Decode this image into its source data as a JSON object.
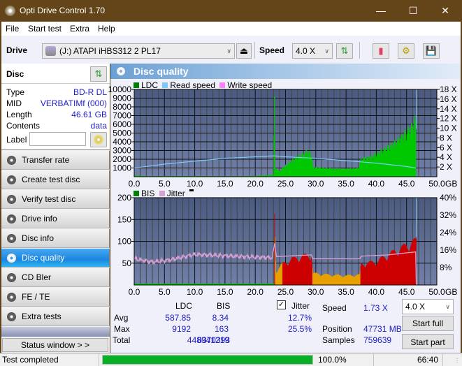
{
  "window": {
    "title": "Opti Drive Control 1.70",
    "minimize": "—",
    "maximize": "☐",
    "close": "✕"
  },
  "menu": [
    "File",
    "Start test",
    "Extra",
    "Help"
  ],
  "toolbar": {
    "drive_label": "Drive",
    "drive_value": "(J:)   ATAPI iHBS312   2 PL17",
    "speed_label": "Speed",
    "speed_value": "4.0 X"
  },
  "disc": {
    "heading": "Disc",
    "type_label": "Type",
    "type_value": "BD-R DL",
    "mid_label": "MID",
    "mid_value": "VERBATIMf (000)",
    "length_label": "Length",
    "length_value": "46.61 GB",
    "contents_label": "Contents",
    "contents_value": "data",
    "label_label": "Label",
    "label_value": ""
  },
  "nav": [
    {
      "label": "Transfer rate",
      "active": false
    },
    {
      "label": "Create test disc",
      "active": false
    },
    {
      "label": "Verify test disc",
      "active": false
    },
    {
      "label": "Drive info",
      "active": false
    },
    {
      "label": "Disc info",
      "active": false
    },
    {
      "label": "Disc quality",
      "active": true
    },
    {
      "label": "CD Bler",
      "active": false
    },
    {
      "label": "FE / TE",
      "active": false
    },
    {
      "label": "Extra tests",
      "active": false
    }
  ],
  "status_window_label": "Status window > >",
  "panel_title": "Disc quality",
  "colors": {
    "ldc": "#00c800",
    "read_speed": "#7fc8f8",
    "write_speed": "#ff80ff",
    "bis_legend": "#008000",
    "jitter": "#d8a0d0",
    "bis_high": "#cc0000",
    "bis_mid": "#e8a000",
    "plot_top": "#4a5a80",
    "plot_bottom": "#7080a8",
    "progress": "#06b025"
  },
  "chart_data": [
    {
      "type": "bar",
      "title": "LDC / Read speed",
      "legend": [
        "LDC",
        "Read speed",
        "Write speed"
      ],
      "x_ticks": [
        "0.0",
        "5.0",
        "10.0",
        "15.0",
        "20.0",
        "25.0",
        "30.0",
        "35.0",
        "40.0",
        "45.0",
        "50.0"
      ],
      "x_unit": "GB",
      "xlim": [
        0,
        50
      ],
      "ylim_left": [
        0,
        10000
      ],
      "y_ticks_left": [
        "1000",
        "2000",
        "3000",
        "4000",
        "5000",
        "6000",
        "7000",
        "8000",
        "9000",
        "10000"
      ],
      "ylim_right": [
        0,
        18
      ],
      "y_ticks_right": [
        "2 X",
        "4 X",
        "6 X",
        "8 X",
        "10 X",
        "12 X",
        "14 X",
        "16 X",
        "18 X"
      ],
      "ldc_series": [
        [
          0,
          150
        ],
        [
          2,
          60
        ],
        [
          5,
          80
        ],
        [
          10,
          80
        ],
        [
          15,
          60
        ],
        [
          20,
          90
        ],
        [
          23,
          200
        ],
        [
          23.2,
          9192
        ],
        [
          23.3,
          1000
        ],
        [
          24,
          600
        ],
        [
          25,
          1200
        ],
        [
          26,
          1700
        ],
        [
          27,
          2200
        ],
        [
          28,
          2400
        ],
        [
          28.5,
          2700
        ],
        [
          29.3,
          2500
        ],
        [
          29.5,
          1100
        ],
        [
          30,
          1000
        ],
        [
          32,
          900
        ],
        [
          34,
          850
        ],
        [
          37,
          900
        ],
        [
          37.5,
          1900
        ],
        [
          39,
          2100
        ],
        [
          41,
          2800
        ],
        [
          43,
          3600
        ],
        [
          45,
          4800
        ],
        [
          46.2,
          5600
        ],
        [
          46.6,
          6700
        ]
      ],
      "read_speed_series": [
        [
          0,
          1.8
        ],
        [
          5,
          2.6
        ],
        [
          10,
          3.2
        ],
        [
          15,
          3.8
        ],
        [
          20,
          4.1
        ],
        [
          23.2,
          4.3
        ],
        [
          25,
          4.1
        ],
        [
          30,
          3.8
        ],
        [
          35,
          3.3
        ],
        [
          40,
          2.8
        ],
        [
          45,
          2.1
        ],
        [
          46.6,
          1.8
        ]
      ],
      "end_marker_gb": 46.61
    },
    {
      "type": "bar",
      "title": "BIS / Jitter",
      "legend": [
        "BIS",
        "Jitter"
      ],
      "x_ticks": [
        "0.0",
        "5.0",
        "10.0",
        "15.0",
        "20.0",
        "25.0",
        "30.0",
        "35.0",
        "40.0",
        "45.0",
        "50.0"
      ],
      "x_unit": "GB",
      "xlim": [
        0,
        50
      ],
      "ylim_left": [
        0,
        200
      ],
      "y_ticks_left": [
        "50",
        "100",
        "150",
        "200"
      ],
      "ylim_right": [
        0,
        40
      ],
      "y_ticks_right": [
        "8%",
        "16%",
        "24%",
        "32%",
        "40%"
      ],
      "bis_series": [
        [
          0,
          2
        ],
        [
          10,
          2
        ],
        [
          20,
          2
        ],
        [
          23,
          3
        ],
        [
          23.2,
          163
        ],
        [
          23.4,
          30
        ],
        [
          24.5,
          45
        ],
        [
          26,
          55
        ],
        [
          28,
          62
        ],
        [
          29.3,
          65
        ],
        [
          29.5,
          25
        ],
        [
          32,
          22
        ],
        [
          35,
          20
        ],
        [
          37.3,
          22
        ],
        [
          37.5,
          45
        ],
        [
          40,
          50
        ],
        [
          42,
          65
        ],
        [
          44,
          78
        ],
        [
          45.5,
          88
        ],
        [
          46.6,
          95
        ]
      ],
      "jitter_series": [
        [
          0,
          12
        ],
        [
          3,
          10.5
        ],
        [
          6,
          11.5
        ],
        [
          10,
          14
        ],
        [
          14,
          13.5
        ],
        [
          18,
          13
        ],
        [
          22.8,
          12.5
        ],
        [
          23.2,
          19
        ],
        [
          23.5,
          13
        ],
        [
          25,
          13.2
        ],
        [
          29.3,
          13.8
        ],
        [
          29.5,
          12
        ],
        [
          37.3,
          12
        ],
        [
          37.5,
          13.2
        ],
        [
          42,
          13.8
        ],
        [
          46.6,
          15.2
        ]
      ],
      "end_marker_gb": 46.61
    }
  ],
  "stats": {
    "col_ldc": "LDC",
    "col_bis": "BIS",
    "jitter_label": "Jitter",
    "jitter_checked": true,
    "avg_label": "Avg",
    "avg_ldc": "587.85",
    "avg_bis": "8.34",
    "avg_jitter": "12.7%",
    "max_label": "Max",
    "max_ldc": "9192",
    "max_bis": "163",
    "max_jitter": "25.5%",
    "total_label": "Total",
    "total_ldc": "448941219",
    "total_bis": "6370393",
    "speed_label": "Speed",
    "speed_value": "1.73 X",
    "position_label": "Position",
    "position_value": "47731 MB",
    "samples_label": "Samples",
    "samples_value": "759639",
    "speed_select": "4.0 X",
    "start_full": "Start full",
    "start_part": "Start part"
  },
  "status": {
    "text": "Test completed",
    "progress_percent": 100.0,
    "progress_label": "100.0%",
    "time": "66:40"
  }
}
